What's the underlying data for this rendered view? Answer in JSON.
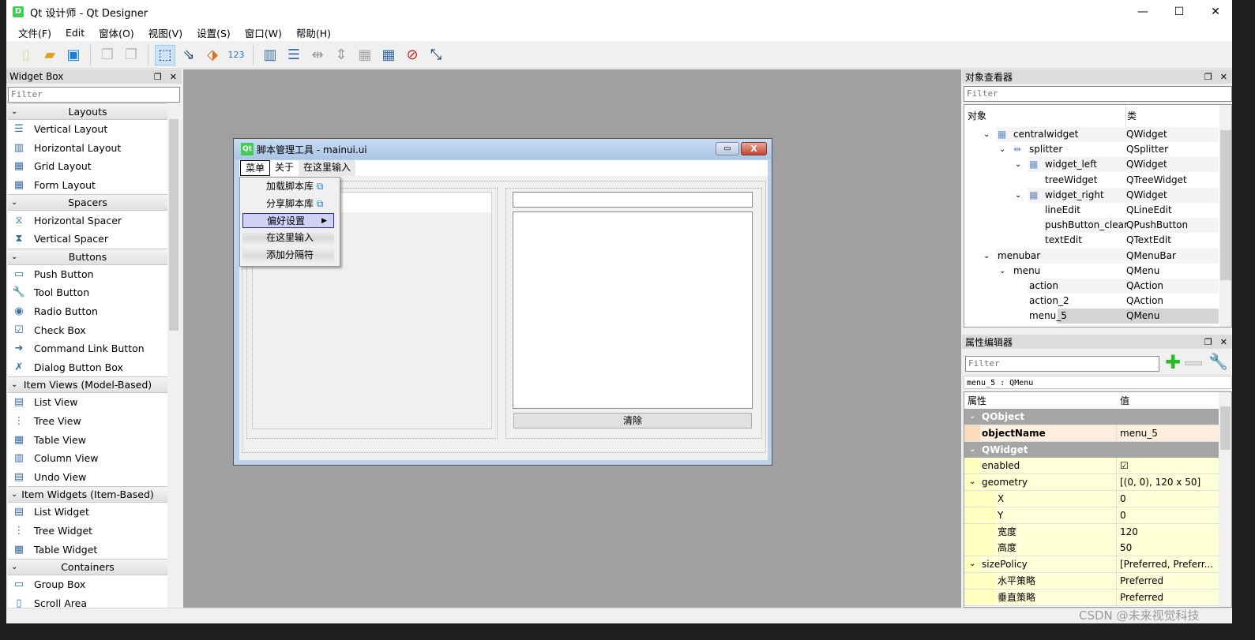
{
  "window": {
    "title": "Qt 设计师 - Qt Designer",
    "logo": "D",
    "minimize": "—",
    "maximize": "☐",
    "close": "✕"
  },
  "menubar": [
    "文件(F)",
    "Edit",
    "窗体(O)",
    "视图(V)",
    "设置(S)",
    "窗口(W)",
    "帮助(H)"
  ],
  "toolbar": [
    "new-file-icon",
    "open-folder-icon",
    "save-icon",
    "send-back-icon",
    "bring-front-icon",
    "edit-widgets-icon",
    "edit-signals-slots-icon",
    "edit-buddies-icon",
    "edit-tab-order-icon",
    "horizontal-layout-icon",
    "vertical-layout-icon",
    "horizontal-splitter-icon",
    "vertical-splitter-icon",
    "grid-layout-icon",
    "form-layout-icon",
    "break-layout-icon",
    "adjust-size-icon"
  ],
  "widget_box": {
    "title": "Widget Box",
    "filter_placeholder": "Filter",
    "categories": [
      {
        "name": "Layouts",
        "items": [
          "Vertical Layout",
          "Horizontal Layout",
          "Grid Layout",
          "Form Layout"
        ]
      },
      {
        "name": "Spacers",
        "items": [
          "Horizontal Spacer",
          "Vertical Spacer"
        ]
      },
      {
        "name": "Buttons",
        "items": [
          "Push Button",
          "Tool Button",
          "Radio Button",
          "Check Box",
          "Command Link Button",
          "Dialog Button Box"
        ]
      },
      {
        "name": "Item Views (Model-Based)",
        "items": [
          "List View",
          "Tree View",
          "Table View",
          "Column View",
          "Undo View"
        ]
      },
      {
        "name": "Item Widgets (Item-Based)",
        "items": [
          "List Widget",
          "Tree Widget",
          "Table Widget"
        ]
      },
      {
        "name": "Containers",
        "items": [
          "Group Box",
          "Scroll Area"
        ]
      }
    ]
  },
  "form": {
    "logo": "Qt",
    "title": "脚本管理工具 - mainui.ui",
    "menus": [
      "菜单",
      "关于",
      "在这里输入"
    ],
    "popup": {
      "items": [
        "加载脚本库",
        "分享脚本库",
        "偏好设置",
        "在这里输入",
        "添加分隔符"
      ],
      "selected": "偏好设置"
    },
    "clear_button": "清除"
  },
  "object_inspector": {
    "title": "对象查看器",
    "filter_placeholder": "Filter",
    "columns": [
      "对象",
      "类"
    ],
    "rows": [
      {
        "name": "centralwidget",
        "class": "QWidget",
        "depth": 0,
        "expanded": true,
        "icon": "grid-layout-icon"
      },
      {
        "name": "splitter",
        "class": "QSplitter",
        "depth": 1,
        "expanded": true,
        "icon": "splitter-icon"
      },
      {
        "name": "widget_left",
        "class": "QWidget",
        "depth": 2,
        "expanded": true,
        "icon": "grid-layout-icon"
      },
      {
        "name": "treeWidget",
        "class": "QTreeWidget",
        "depth": 3
      },
      {
        "name": "widget_right",
        "class": "QWidget",
        "depth": 2,
        "expanded": true,
        "icon": "grid-layout-icon"
      },
      {
        "name": "lineEdit",
        "class": "QLineEdit",
        "depth": 3
      },
      {
        "name": "pushButton_clear",
        "class": "QPushButton",
        "depth": 3
      },
      {
        "name": "textEdit",
        "class": "QTextEdit",
        "depth": 3
      },
      {
        "name": "menubar",
        "class": "QMenuBar",
        "depth": 0,
        "expanded": true
      },
      {
        "name": "menu",
        "class": "QMenu",
        "depth": 1,
        "expanded": true
      },
      {
        "name": "action",
        "class": "QAction",
        "depth": 2
      },
      {
        "name": "action_2",
        "class": "QAction",
        "depth": 2
      },
      {
        "name": "menu_5",
        "class": "QMenu",
        "depth": 2,
        "selected": true
      }
    ]
  },
  "property_editor": {
    "title": "属性编辑器",
    "filter_placeholder": "Filter",
    "object_label": "menu_5 : QMenu",
    "columns": [
      "属性",
      "值"
    ],
    "rows": [
      {
        "type": "group",
        "name": "QObject"
      },
      {
        "name": "objectName",
        "value": "menu_5",
        "bold": true
      },
      {
        "type": "group",
        "name": "QWidget"
      },
      {
        "name": "enabled",
        "value": "☑"
      },
      {
        "name": "geometry",
        "value": "[(0, 0), 120 x 50]",
        "expanded": true
      },
      {
        "name": "X",
        "value": "0",
        "sub": true
      },
      {
        "name": "Y",
        "value": "0",
        "sub": true
      },
      {
        "name": "宽度",
        "value": "120",
        "sub": true
      },
      {
        "name": "高度",
        "value": "50",
        "sub": true
      },
      {
        "name": "sizePolicy",
        "value": "[Preferred, Preferr...",
        "expanded": true
      },
      {
        "name": "水平策略",
        "value": "Preferred",
        "sub": true
      },
      {
        "name": "垂直策略",
        "value": "Preferred",
        "sub": true
      }
    ]
  },
  "watermark": "CSDN @未来视觉科技"
}
